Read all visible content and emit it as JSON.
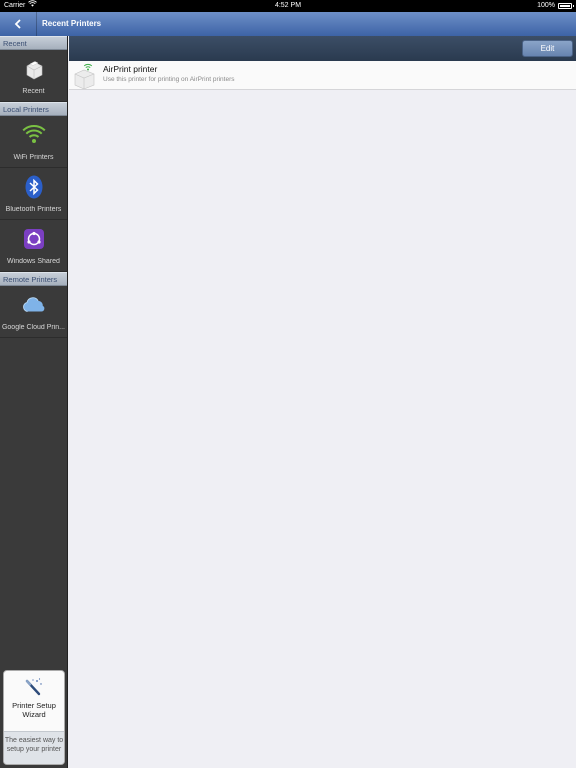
{
  "status_bar": {
    "carrier": "Carrier",
    "time": "4:52 PM",
    "battery": "100%"
  },
  "nav": {
    "title": "Recent Printers"
  },
  "toolbar": {
    "edit_label": "Edit"
  },
  "sidebar": {
    "sections": [
      {
        "header": "Recent",
        "items": [
          {
            "label": "Recent",
            "icon": "printer-icon"
          }
        ]
      },
      {
        "header": "Local Printers",
        "items": [
          {
            "label": "WiFi Printers",
            "icon": "wifi-icon"
          },
          {
            "label": "Bluetooth Printers",
            "icon": "bluetooth-icon"
          },
          {
            "label": "Windows Shared",
            "icon": "windows-shared-icon"
          }
        ]
      },
      {
        "header": "Remote Printers",
        "items": [
          {
            "label": "Google Cloud Prin...",
            "icon": "cloud-icon"
          }
        ]
      }
    ]
  },
  "wizard": {
    "title": "Printer Setup Wizard",
    "subtitle": "The easiest way to setup your printer"
  },
  "printers": [
    {
      "name": "AirPrint printer",
      "description": "Use this printer for printing on AirPrint printers",
      "icon": "airprint-printer-icon"
    }
  ],
  "colors": {
    "nav_blue": "#3d63a6",
    "sidebar_bg": "#3a3a3a",
    "section_header": "#a6b0bd",
    "wifi_green": "#7ac143",
    "bluetooth_blue": "#2b5fc9",
    "windows_purple": "#7b3fc2",
    "cloud_blue": "#7fb3e8"
  }
}
